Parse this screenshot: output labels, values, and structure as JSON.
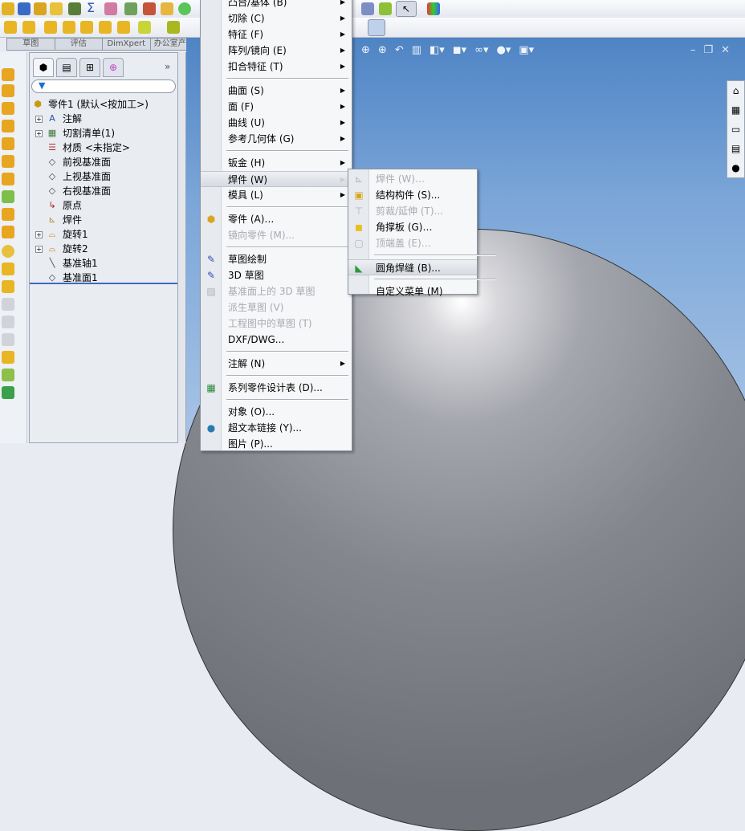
{
  "command_tabs": [
    "草图",
    "评估",
    "DimXpert",
    "办公室产品"
  ],
  "feature_tree": {
    "root": "零件1 (默认<按加工>)",
    "items": [
      {
        "label": "注解",
        "expand": true,
        "icon": "annotation-icon"
      },
      {
        "label": "切割清单(1)",
        "expand": true,
        "icon": "cut-list-icon"
      },
      {
        "label": "材质 <未指定>",
        "expand": false,
        "icon": "material-icon"
      },
      {
        "label": "前视基准面",
        "expand": false,
        "icon": "plane-icon"
      },
      {
        "label": "上视基准面",
        "expand": false,
        "icon": "plane-icon"
      },
      {
        "label": "右视基准面",
        "expand": false,
        "icon": "plane-icon"
      },
      {
        "label": "原点",
        "expand": false,
        "icon": "origin-icon"
      },
      {
        "label": "焊件",
        "expand": false,
        "icon": "weldment-icon"
      },
      {
        "label": "旋转1",
        "expand": true,
        "icon": "revolve-icon"
      },
      {
        "label": "旋转2",
        "expand": true,
        "icon": "revolve-icon"
      },
      {
        "label": "基准轴1",
        "expand": false,
        "icon": "axis-icon"
      },
      {
        "label": "基准面1",
        "expand": false,
        "icon": "plane-icon"
      }
    ],
    "more": "»"
  },
  "insert_menu": [
    {
      "label": "凸台/基体 (B)",
      "sub": true
    },
    {
      "label": "切除 (C)",
      "sub": true
    },
    {
      "label": "特征 (F)",
      "sub": true
    },
    {
      "label": "阵列/镜向 (E)",
      "sub": true
    },
    {
      "label": "扣合特征 (T)",
      "sub": true
    },
    {
      "sep": true
    },
    {
      "label": "曲面 (S)",
      "sub": true
    },
    {
      "label": "面 (F)",
      "sub": true
    },
    {
      "label": "曲线 (U)",
      "sub": true
    },
    {
      "label": "参考几何体 (G)",
      "sub": true
    },
    {
      "sep": true
    },
    {
      "label": "钣金 (H)",
      "sub": true
    },
    {
      "label": "焊件 (W)",
      "sub": true,
      "highlighted": true
    },
    {
      "label": "模具 (L)",
      "sub": true
    },
    {
      "sep": true
    },
    {
      "label": "零件 (A)…",
      "icon": "part-icon"
    },
    {
      "label": "镜向零件 (M)...",
      "disabled": true
    },
    {
      "sep": true
    },
    {
      "label": "草图绘制",
      "icon": "sketch-icon"
    },
    {
      "label": "3D 草图",
      "icon": "3d-sketch-icon"
    },
    {
      "label": "基准面上的 3D 草图",
      "disabled": true,
      "icon": "3d-sketch-plane-icon"
    },
    {
      "label": "派生草图 (V)",
      "disabled": true
    },
    {
      "label": "工程图中的草图 (T)",
      "disabled": true
    },
    {
      "label": "DXF/DWG..."
    },
    {
      "sep": true
    },
    {
      "label": "注解 (N)",
      "sub": true
    },
    {
      "sep": true
    },
    {
      "label": "系列零件设计表 (D)...",
      "icon": "design-table-icon"
    },
    {
      "sep": true
    },
    {
      "label": "对象 (O)..."
    },
    {
      "label": "超文本链接 (Y)...",
      "icon": "hyperlink-icon"
    },
    {
      "label": "图片 (P)..."
    }
  ],
  "weldment_submenu": [
    {
      "label": "焊件 (W)…",
      "disabled": true,
      "icon": "weldment-icon"
    },
    {
      "label": "结构构件 (S)...",
      "icon": "structural-member-icon"
    },
    {
      "label": "剪裁/延伸 (T)...",
      "disabled": true,
      "icon": "trim-extend-icon"
    },
    {
      "label": "角撑板 (G)…",
      "icon": "gusset-icon"
    },
    {
      "label": "顶端盖 (E)…",
      "disabled": true,
      "icon": "end-cap-icon"
    },
    {
      "sep": true
    },
    {
      "label": "圆角焊缝 (B)...",
      "highlighted": true,
      "icon": "fillet-bead-icon"
    },
    {
      "sep": true
    },
    {
      "label": "自定义菜单 (M)"
    }
  ]
}
